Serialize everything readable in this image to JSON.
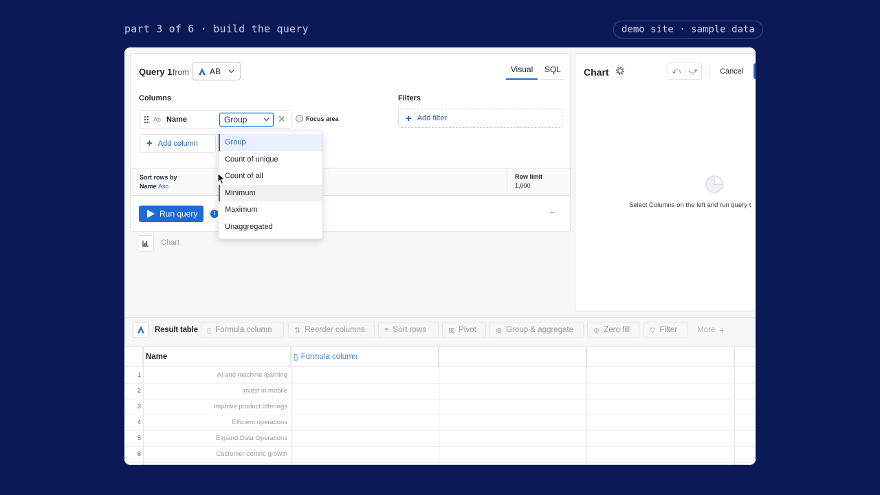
{
  "header": {
    "step_label": "part 3 of 6 · build the query",
    "demo_badge": "demo site · sample data"
  },
  "query": {
    "title": "Query 1",
    "from_label": "from",
    "datasource": "AB",
    "tabs": [
      {
        "label": "Visual",
        "active": true
      },
      {
        "label": "SQL",
        "active": false
      }
    ],
    "columns_label": "Columns",
    "filters_label": "Filters",
    "column": {
      "type_badge": "Ab",
      "name": "Name",
      "aggregation": "Group",
      "focus_label": "Focus area"
    },
    "add_column_label": "Add column",
    "add_filter_label": "Add filter",
    "sort": {
      "label": "Sort rows by",
      "field": "Name",
      "direction": "Asc"
    },
    "row_limit": {
      "label": "Row limit",
      "value": "1,000"
    },
    "run_label": "Run query",
    "collapse_symbol": "–",
    "chart_strip_label": "Chart"
  },
  "aggregation_menu": {
    "options": [
      "Group",
      "Count of unique",
      "Count of all",
      "Minimum",
      "Maximum",
      "Unaggregated"
    ],
    "selected": "Group",
    "hovered": "Minimum"
  },
  "chart_panel": {
    "title": "Chart",
    "cancel_label": "Cancel",
    "hint": "Select Columns on the left and run query t"
  },
  "toolbar": {
    "items": [
      "Result table",
      "Formula column",
      "Reorder columns",
      "Sort rows",
      "Pivot",
      "Group & aggregate",
      "Zero fill",
      "Filter",
      "More"
    ]
  },
  "table": {
    "headers": [
      "Name",
      "Formula column"
    ],
    "rows": [
      {
        "n": "1",
        "name": "AI and machine learning"
      },
      {
        "n": "2",
        "name": "Invest in mobile"
      },
      {
        "n": "3",
        "name": "Improve product offerings"
      },
      {
        "n": "4",
        "name": "Efficient operations"
      },
      {
        "n": "5",
        "name": "Expand Data Operations"
      },
      {
        "n": "6",
        "name": "Customer-centric growth"
      }
    ]
  },
  "colors": {
    "background": "#0c1957",
    "accent": "#1f6bd6"
  }
}
